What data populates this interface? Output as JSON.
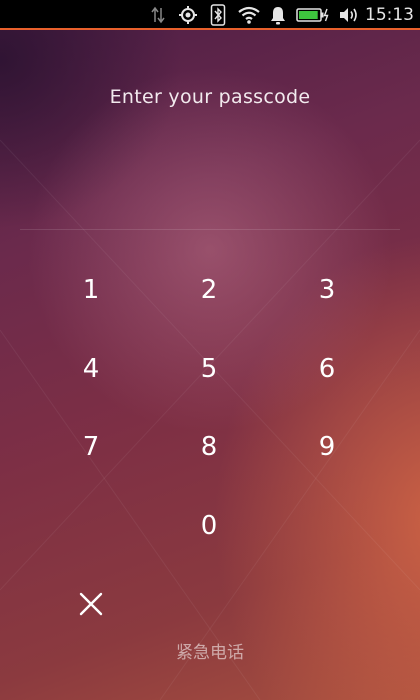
{
  "status_bar": {
    "time": "15:13",
    "icons": [
      "data-transfer-icon",
      "location-icon",
      "bluetooth-icon",
      "wifi-icon",
      "notification-bell-icon",
      "battery-charging-icon",
      "volume-icon"
    ],
    "battery_level": 0.85,
    "accent_color": "#e8602c"
  },
  "lockscreen": {
    "prompt": "Enter your passcode",
    "keys": [
      "1",
      "2",
      "3",
      "4",
      "5",
      "6",
      "7",
      "8",
      "9",
      "0"
    ],
    "delete_icon": "close-icon",
    "emergency_call": "紧急电话"
  }
}
